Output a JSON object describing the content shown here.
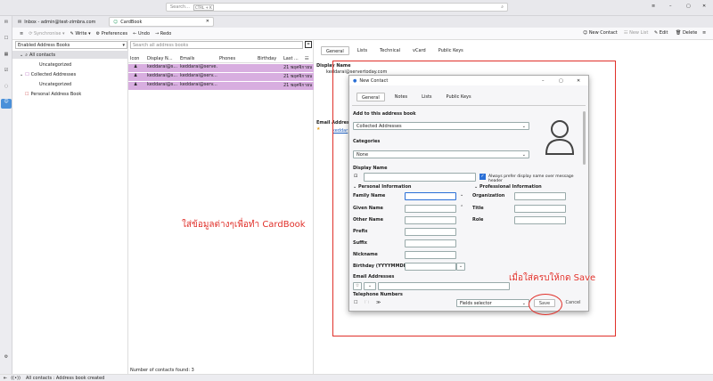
{
  "titlebar": {
    "search_placeholder": "Search...",
    "search_shortcut": "CTRL + K",
    "win_controls": [
      "≡",
      "–",
      "▢",
      "✕"
    ]
  },
  "tabs": [
    {
      "label": "Inbox - admin@test-zimbra.com"
    },
    {
      "label": "CardBook"
    }
  ],
  "toolbar": {
    "sync": "Synchronise",
    "write": "Write",
    "preferences": "Preferences",
    "undo": "Undo",
    "redo": "Redo",
    "new_contact": "New Contact",
    "new_list": "New List",
    "edit": "Edit",
    "delete": "Delete"
  },
  "sidebar": {
    "dropdown": "Enabled Address Books",
    "items": [
      {
        "label": "All contacts"
      },
      {
        "label": "Uncategorized"
      },
      {
        "label": "Collected Addresses"
      },
      {
        "label": "Uncategorized"
      },
      {
        "label": "Personal Address Book"
      }
    ]
  },
  "list": {
    "search_placeholder": "Search all address books",
    "columns": [
      "Icon",
      "Display N...",
      "Emails",
      "Phones",
      "Birthday",
      "Last ...",
      ""
    ],
    "rows": [
      {
        "name": "keddarai@s...",
        "email": "keddarai@serve...",
        "last": "21 พฤศจิกายน..."
      },
      {
        "name": "keddarai@s...",
        "email": "keddarai@serv...",
        "last": "21 พฤศจิกายน..."
      },
      {
        "name": "keddarai@s...",
        "email": "keddarai@serv...",
        "last": "21 พฤศจิกายน..."
      }
    ],
    "footer": "Number of contacts found: 3"
  },
  "detail": {
    "tabs": [
      "General",
      "Lists",
      "Technical",
      "vCard",
      "Public Keys"
    ],
    "display_name_label": "Display Name",
    "display_name_value": "keddarai@servertoday.com",
    "email_label": "Email Addresses",
    "email_value": "keddar"
  },
  "dialog": {
    "title": "New Contact",
    "tabs": [
      "General",
      "Notes",
      "Lists",
      "Public Keys"
    ],
    "add_to_label": "Add to this address book",
    "add_to_value": "Collected Addresses",
    "categories_label": "Categories",
    "categories_value": "None",
    "display_name_label": "Display Name",
    "prefer_display": "Always prefer display name over message header",
    "personal_info": "Personal Information",
    "professional_info": "Professional Information",
    "personal_fields": [
      "Family Name",
      "Given Name",
      "Other Name",
      "Prefix",
      "Suffix",
      "Nickname",
      "Birthday (YYYYMMDD)"
    ],
    "professional_fields": [
      "Organization",
      "Title",
      "Role"
    ],
    "email_label": "Email Addresses",
    "telephone_label": "Telephone Numbers",
    "fields_selector": "Fields selector",
    "save": "Save",
    "cancel": "Cancel"
  },
  "annotations": {
    "left": "ใส่ข้อมูลต่างๆเพื่อทำ CardBook",
    "right": "เมื่อใส่ครบให้กด Save",
    "color": "#e0302a"
  },
  "status": {
    "text": "All contacts : Address book created"
  }
}
